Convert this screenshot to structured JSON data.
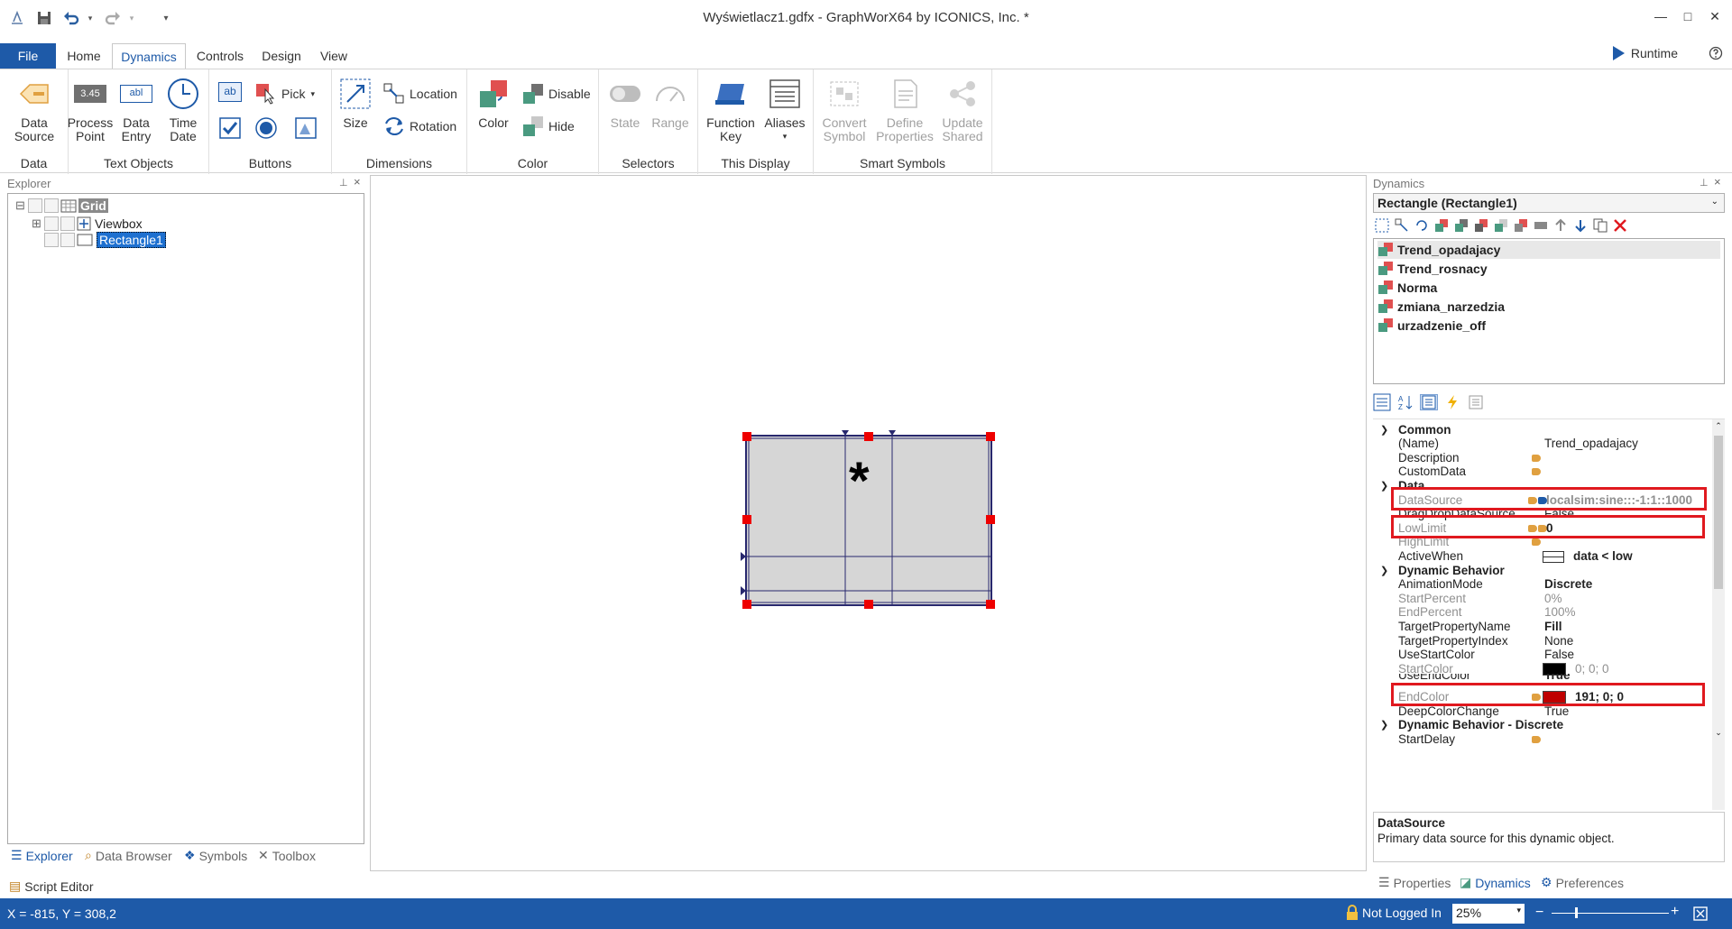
{
  "window": {
    "title": "Wyświetlacz1.gdfx - GraphWorX64 by ICONICS, Inc. *",
    "minimize": "—",
    "maximize": "□",
    "close": "✕"
  },
  "tabs": [
    "File",
    "Home",
    "Dynamics",
    "Controls",
    "Design",
    "View"
  ],
  "runtime_label": "Runtime",
  "ribbon": {
    "data": {
      "label": "Data",
      "data_source": [
        "Data",
        "Source"
      ]
    },
    "text_objects": {
      "label": "Text Objects",
      "process_point": [
        "Process",
        "Point"
      ],
      "process_point_icon_text": "3.45",
      "data_entry": [
        "Data",
        "Entry"
      ],
      "data_entry_icon_text": "abl",
      "time_date": [
        "Time",
        "Date"
      ]
    },
    "buttons": {
      "label": "Buttons",
      "pick": "Pick",
      "ab_icon_text": "ab"
    },
    "dimensions": {
      "label": "Dimensions",
      "size": "Size",
      "location": "Location",
      "rotation": "Rotation"
    },
    "color": {
      "label": "Color",
      "color": "Color",
      "disable": "Disable",
      "hide": "Hide"
    },
    "selectors": {
      "label": "Selectors",
      "state": "State",
      "range": "Range"
    },
    "this_display": {
      "label": "This Display",
      "function_key": [
        "Function",
        "Key"
      ],
      "aliases": "Aliases"
    },
    "smart_symbols": {
      "label": "Smart Symbols",
      "convert_symbol": [
        "Convert",
        "Symbol"
      ],
      "define_properties": [
        "Define",
        "Properties"
      ],
      "update_shared": [
        "Update",
        "Shared"
      ]
    }
  },
  "explorer": {
    "header": "Explorer",
    "tree": [
      {
        "label": "Grid",
        "expander": "⊟"
      },
      {
        "label": "Viewbox",
        "expander": "⊞"
      },
      {
        "label": "Rectangle1"
      }
    ],
    "bottom_tabs": [
      "Explorer",
      "Data Browser",
      "Symbols",
      "Toolbox"
    ],
    "script_editor": "Script Editor"
  },
  "canvas": {
    "asterisk": "*"
  },
  "dynamics": {
    "header": "Dynamics",
    "selected_object": "Rectangle (Rectangle1)",
    "items": [
      "Trend_opadajacy",
      "Trend_rosnacy",
      "Norma",
      "zmiana_narzedzia",
      "urzadzenie_off"
    ],
    "properties": [
      {
        "type": "cat",
        "name": "Common"
      },
      {
        "name": "(Name)",
        "value": "Trend_opadajacy"
      },
      {
        "name": "Description",
        "value": ""
      },
      {
        "name": "CustomData",
        "value": ""
      },
      {
        "type": "cat",
        "name": "Data"
      },
      {
        "name": "DataSource",
        "value": "localsim:sine:::-1:1::1000"
      },
      {
        "name": "DragDropDataSource",
        "value": "False"
      },
      {
        "name": "LowLimit",
        "value": "0"
      },
      {
        "name": "HighLimit",
        "value": ""
      },
      {
        "name": "ActiveWhen",
        "value": "data < low"
      },
      {
        "type": "cat",
        "name": "Dynamic Behavior"
      },
      {
        "name": "AnimationMode",
        "value": "Discrete"
      },
      {
        "name": "StartPercent",
        "value": "0%"
      },
      {
        "name": "EndPercent",
        "value": "100%"
      },
      {
        "name": "TargetPropertyName",
        "value": "Fill"
      },
      {
        "name": "TargetPropertyIndex",
        "value": "None"
      },
      {
        "name": "UseStartColor",
        "value": "False"
      },
      {
        "name": "StartColor",
        "value": "0; 0; 0"
      },
      {
        "name": "UseEndColor",
        "value": "True"
      },
      {
        "name": "EndColor",
        "value": "191; 0; 0"
      },
      {
        "name": "DeepColorChange",
        "value": "True"
      },
      {
        "type": "cat",
        "name": "Dynamic Behavior - Discrete"
      },
      {
        "name": "StartDelay",
        "value": ""
      }
    ],
    "desc_title": "DataSource",
    "desc_text": "Primary data source for this dynamic object.",
    "bottom_tabs": [
      "Properties",
      "Dynamics",
      "Preferences"
    ]
  },
  "status": {
    "coords": "X = -815, Y = 308,2",
    "login": "Not Logged In",
    "zoom": "25%"
  },
  "colors": {
    "accent": "#1e5aa8",
    "highlight": "#e0191f",
    "end_color": "#bf0000",
    "start_color": "#000000"
  }
}
